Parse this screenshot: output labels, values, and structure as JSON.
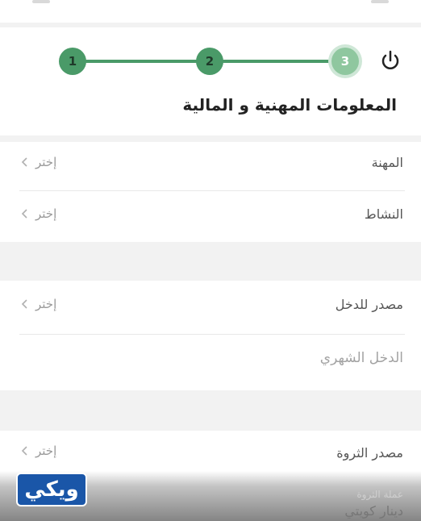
{
  "stepper": {
    "steps": [
      "1",
      "2",
      "3"
    ],
    "active_step": 3,
    "color": "#4a9a68"
  },
  "icons": {
    "power": "power-icon",
    "chevron": "chevron-left-icon"
  },
  "page": {
    "title": "المعلومات المهنية و المالية"
  },
  "fields": {
    "profession": {
      "label": "المهنة",
      "action": "إختر"
    },
    "activity": {
      "label": "النشاط",
      "action": "إختر"
    },
    "income_source": {
      "label": "مصدر للدخل",
      "action": "إختر"
    },
    "monthly_income": {
      "placeholder": "الدخل الشهري"
    },
    "wealth_source": {
      "label": "مصدر الثروة",
      "action": "إختر"
    },
    "currency": {
      "label": "عملة الثروة",
      "value": "دينار كويتي"
    }
  },
  "watermark": {
    "text": "ويكي"
  }
}
